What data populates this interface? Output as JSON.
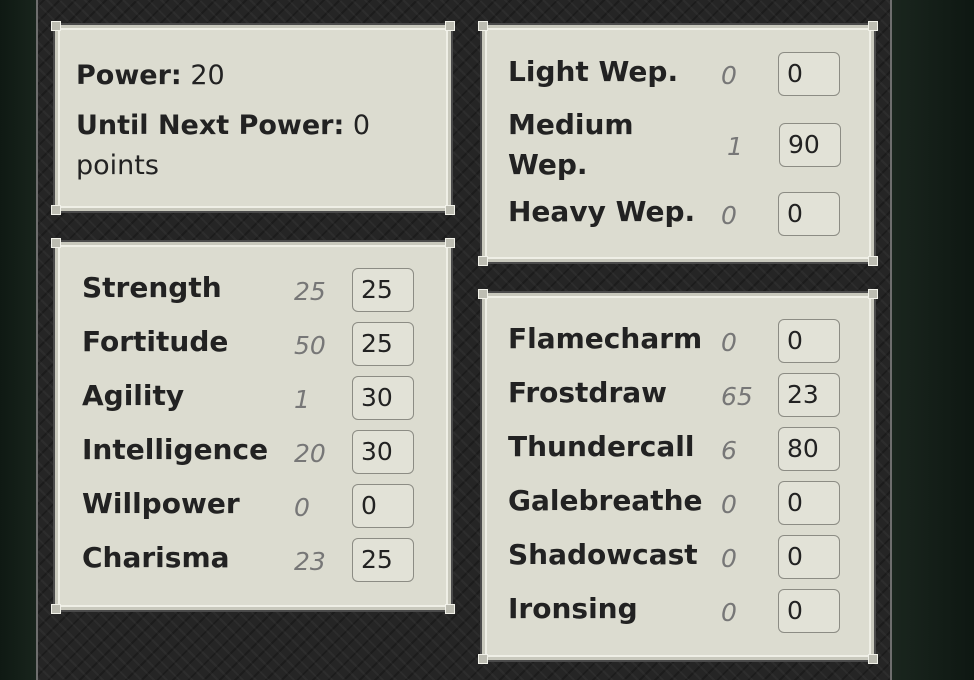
{
  "power_panel": {
    "power_label": "Power:",
    "power_value": "20",
    "until_label": "Until Next Power:",
    "until_value": "0",
    "until_unit": "points"
  },
  "weapons": [
    {
      "label": "Light Wep.",
      "base": "0",
      "value": "0"
    },
    {
      "label_line1": "Medium",
      "label_line2": "Wep.",
      "base": "1",
      "value": "90"
    },
    {
      "label": "Heavy Wep.",
      "base": "0",
      "value": "0"
    }
  ],
  "stats": [
    {
      "label": "Strength",
      "base": "25",
      "value": "25"
    },
    {
      "label": "Fortitude",
      "base": "50",
      "value": "25"
    },
    {
      "label": "Agility",
      "base": "1",
      "value": "30"
    },
    {
      "label": "Intelligence",
      "base": "20",
      "value": "30"
    },
    {
      "label": "Willpower",
      "base": "0",
      "value": "0"
    },
    {
      "label": "Charisma",
      "base": "23",
      "value": "25"
    }
  ],
  "magic": [
    {
      "label": "Flamecharm",
      "base": "0",
      "value": "0"
    },
    {
      "label": "Frostdraw",
      "base": "65",
      "value": "23"
    },
    {
      "label": "Thundercall",
      "base": "6",
      "value": "80"
    },
    {
      "label": "Galebreathe",
      "base": "0",
      "value": "0"
    },
    {
      "label": "Shadowcast",
      "base": "0",
      "value": "0"
    },
    {
      "label": "Ironsing",
      "base": "0",
      "value": "0"
    }
  ],
  "colors": {
    "panel_bg": "#dcdcd0",
    "board_bg": "#252525",
    "outer_bg": "#141d17"
  }
}
